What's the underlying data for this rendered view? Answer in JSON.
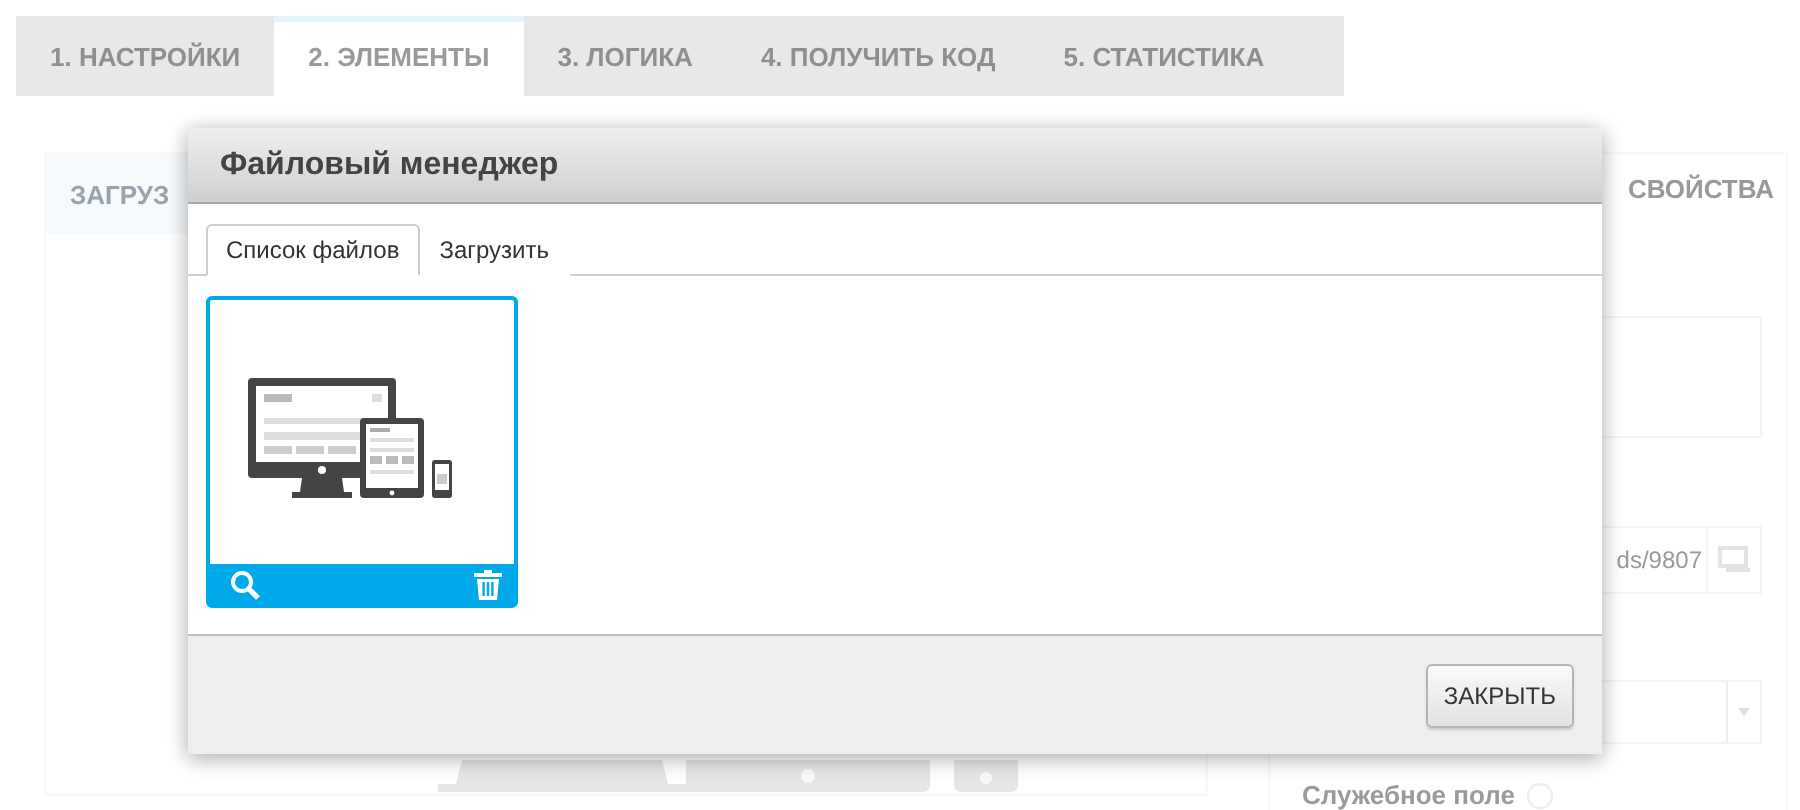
{
  "nav_tabs": [
    {
      "label": "1. НАСТРОЙКИ",
      "selected": false
    },
    {
      "label": "2. ЭЛЕМЕНТЫ",
      "selected": true
    },
    {
      "label": "3. ЛОГИКА",
      "selected": false
    },
    {
      "label": "4. ПОЛУЧИТЬ КОД",
      "selected": false
    },
    {
      "label": "5. СТАТИСТИКА",
      "selected": false
    }
  ],
  "background": {
    "left_panel_title": "ЗАГРУЗ",
    "right_panel_title": "СВОЙСТВА",
    "url_field_value": "ds/9807",
    "service_field_label": "Служебное поле"
  },
  "dialog": {
    "title": "Файловый менеджер",
    "tabs": [
      {
        "label": "Список файлов",
        "selected": true
      },
      {
        "label": "Загрузить",
        "selected": false
      }
    ],
    "files": [
      {
        "kind": "picture",
        "selected": true
      }
    ],
    "close_button": "ЗАКРЫТЬ"
  }
}
